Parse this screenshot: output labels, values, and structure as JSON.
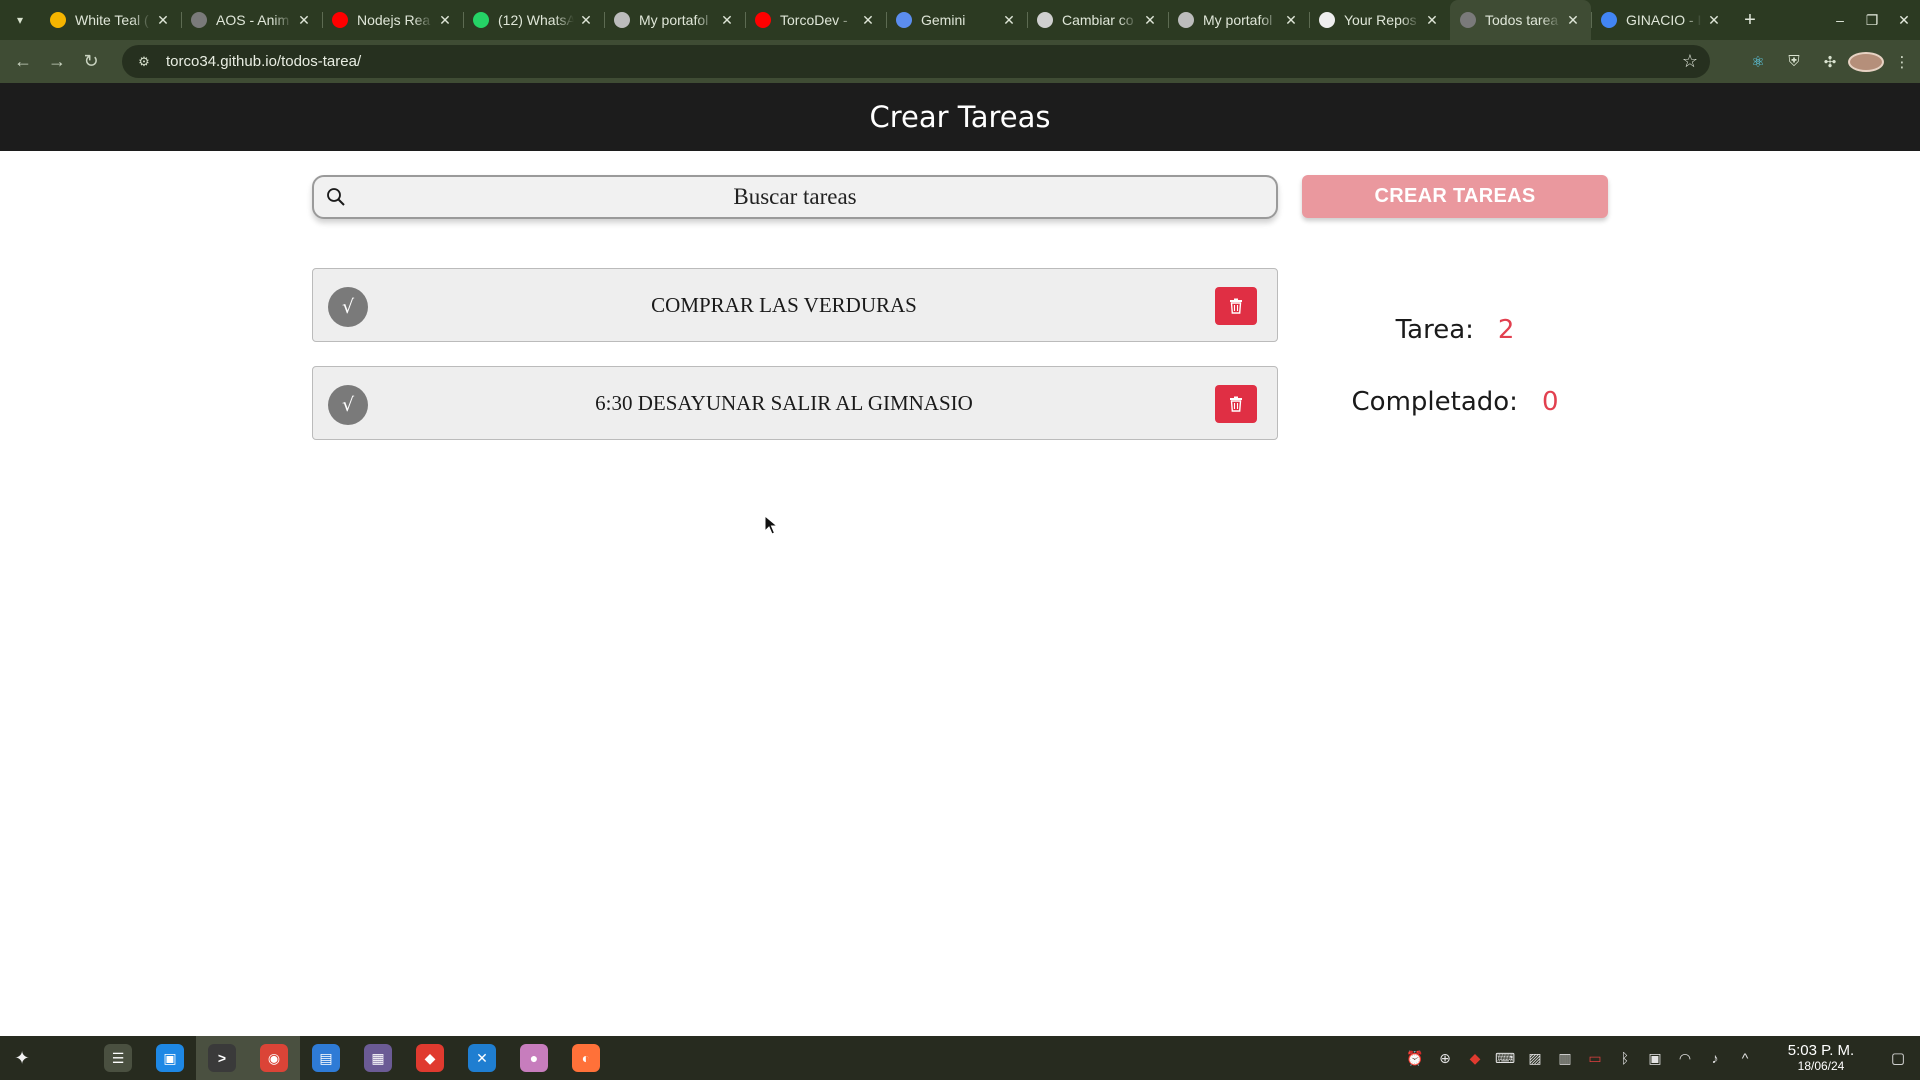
{
  "browser": {
    "tabs": [
      {
        "title": "White Teal (",
        "icon": "slides-icon",
        "color": "#f5b400",
        "active": false
      },
      {
        "title": "AOS - Anim",
        "icon": "globe-icon",
        "color": "#7a7a7a",
        "active": false
      },
      {
        "title": "Nodejs Rea",
        "icon": "youtube-icon",
        "color": "#ff0000",
        "active": false
      },
      {
        "title": "(12) WhatsA",
        "icon": "whatsapp-icon",
        "color": "#25d366",
        "active": false
      },
      {
        "title": "My portafol",
        "icon": "portfolio-icon",
        "color": "#bcbcbc",
        "active": false
      },
      {
        "title": "TorcoDev -",
        "icon": "youtube-icon",
        "color": "#ff0000",
        "active": false
      },
      {
        "title": "Gemini",
        "icon": "gemini-icon",
        "color": "#5b8def",
        "active": false
      },
      {
        "title": "Cambiar co",
        "icon": "openai-icon",
        "color": "#cfcfcf",
        "active": false
      },
      {
        "title": "My portafol",
        "icon": "portfolio-icon",
        "color": "#bcbcbc",
        "active": false
      },
      {
        "title": "Your Repos",
        "icon": "github-icon",
        "color": "#eeeeee",
        "active": false
      },
      {
        "title": "Todos tarea",
        "icon": "globe-icon",
        "color": "#7a7a7a",
        "active": true
      },
      {
        "title": "GINACIO - I",
        "icon": "google-icon",
        "color": "#4285f4",
        "active": false
      }
    ],
    "url": "torco34.github.io/todos-tarea/"
  },
  "app": {
    "header_title": "Crear Tareas",
    "search_placeholder": "Buscar tareas",
    "create_button": "CREAR TAREAS",
    "todos": [
      {
        "text": "COMPRAR LAS VERDURAS",
        "check_symbol": "√"
      },
      {
        "text": "6:30 DESAYUNAR SALIR AL GIMNASIO",
        "check_symbol": "√"
      }
    ],
    "counters": {
      "total_label": "Tarea:",
      "total_value": "2",
      "completed_label": "Completado:",
      "completed_value": "0"
    },
    "accent_color": "#e2404f"
  },
  "taskbar": {
    "apps": [
      {
        "name": "settings-app",
        "color": "#4a5040",
        "glyph": "☰"
      },
      {
        "name": "store-app",
        "color": "#1e88e5",
        "glyph": "▣"
      },
      {
        "name": "terminal-app",
        "color": "#3a3a3a",
        "glyph": ">"
      },
      {
        "name": "chrome-app",
        "color": "#db4437",
        "glyph": "◉"
      },
      {
        "name": "files-app",
        "color": "#2e7bd6",
        "glyph": "▤"
      },
      {
        "name": "video-app",
        "color": "#6b5b95",
        "glyph": "▦"
      },
      {
        "name": "git-app",
        "color": "#e03a2f",
        "glyph": "◆"
      },
      {
        "name": "vscode-app",
        "color": "#1f7ed1",
        "glyph": "✕"
      },
      {
        "name": "chat-app",
        "color": "#c77dbd",
        "glyph": "●"
      },
      {
        "name": "firefox-app",
        "color": "#ff7139",
        "glyph": "◐"
      }
    ],
    "clock_time": "5:03 P. M.",
    "clock_date": "18/06/24"
  }
}
